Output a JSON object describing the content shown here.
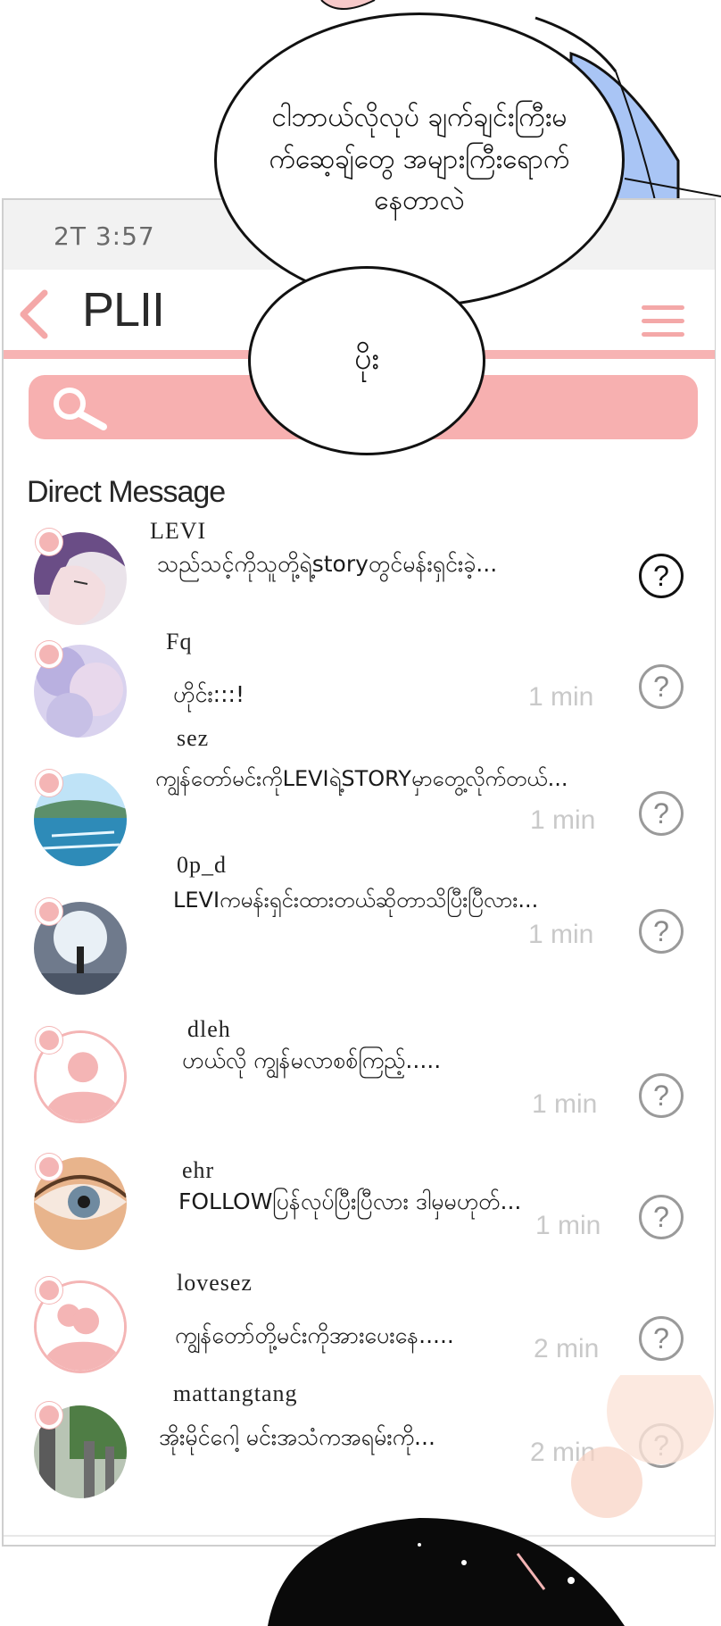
{
  "speech_bubbles": {
    "top": "ငါဘာယ်လိုလုပ် ချက်ချင်းကြီးမက်ဆေ့ချ်တွေ အများကြီးရောက်နေတာလဲ",
    "middle": "ပိုး"
  },
  "status_bar": {
    "time": "2T 3:57"
  },
  "app": {
    "title": "PLII"
  },
  "section_title": "Direct Message",
  "messages": [
    {
      "name": "LEVI",
      "text": "သည်သင့်ကိုသူတို့ရဲ့storyတွင်မန်းရှင်းခဲ့...",
      "time": ""
    },
    {
      "name": "Fq",
      "text": "ဟိုင်း:::!",
      "time": "1 min"
    },
    {
      "name": "sez",
      "text": "ကျွန်တော်မင်းကိုLEVIရဲ့STORYမှာတွေ့လိုက်တယ်...",
      "time": "1 min"
    },
    {
      "name": "0p_d",
      "text": "LEVIကမန်းရှင်းထားတယ်ဆိုတာသိပြီးပြီလား...",
      "time": "1 min"
    },
    {
      "name": "dleh",
      "text": "ဟယ်လို ကျွန်မလာစစ်ကြည့်.....",
      "time": "1 min"
    },
    {
      "name": "ehr",
      "text": "FOLLOWပြန်လုပ်ပြီးပြီလား ဒါမှမဟုတ်...",
      "time": "1 min"
    },
    {
      "name": "lovesez",
      "text": "ကျွန်တော်တို့မင်းကိုအားပေးနေ.....",
      "time": "2 min"
    },
    {
      "name": "mattangtang",
      "text": "အိုးမိုင်ဂေါ့ မင်းအသံကအရမ်းကို...",
      "time": "2 min"
    }
  ],
  "icons": {
    "back": "chevron-left-icon",
    "menu": "hamburger-menu-icon",
    "search": "search-icon",
    "help": "question-circle-icon"
  },
  "colors": {
    "accent_pink": "#f7b0b0",
    "avatar_placeholder": "#f4b5b5",
    "time_gray": "#c9c9c9"
  }
}
